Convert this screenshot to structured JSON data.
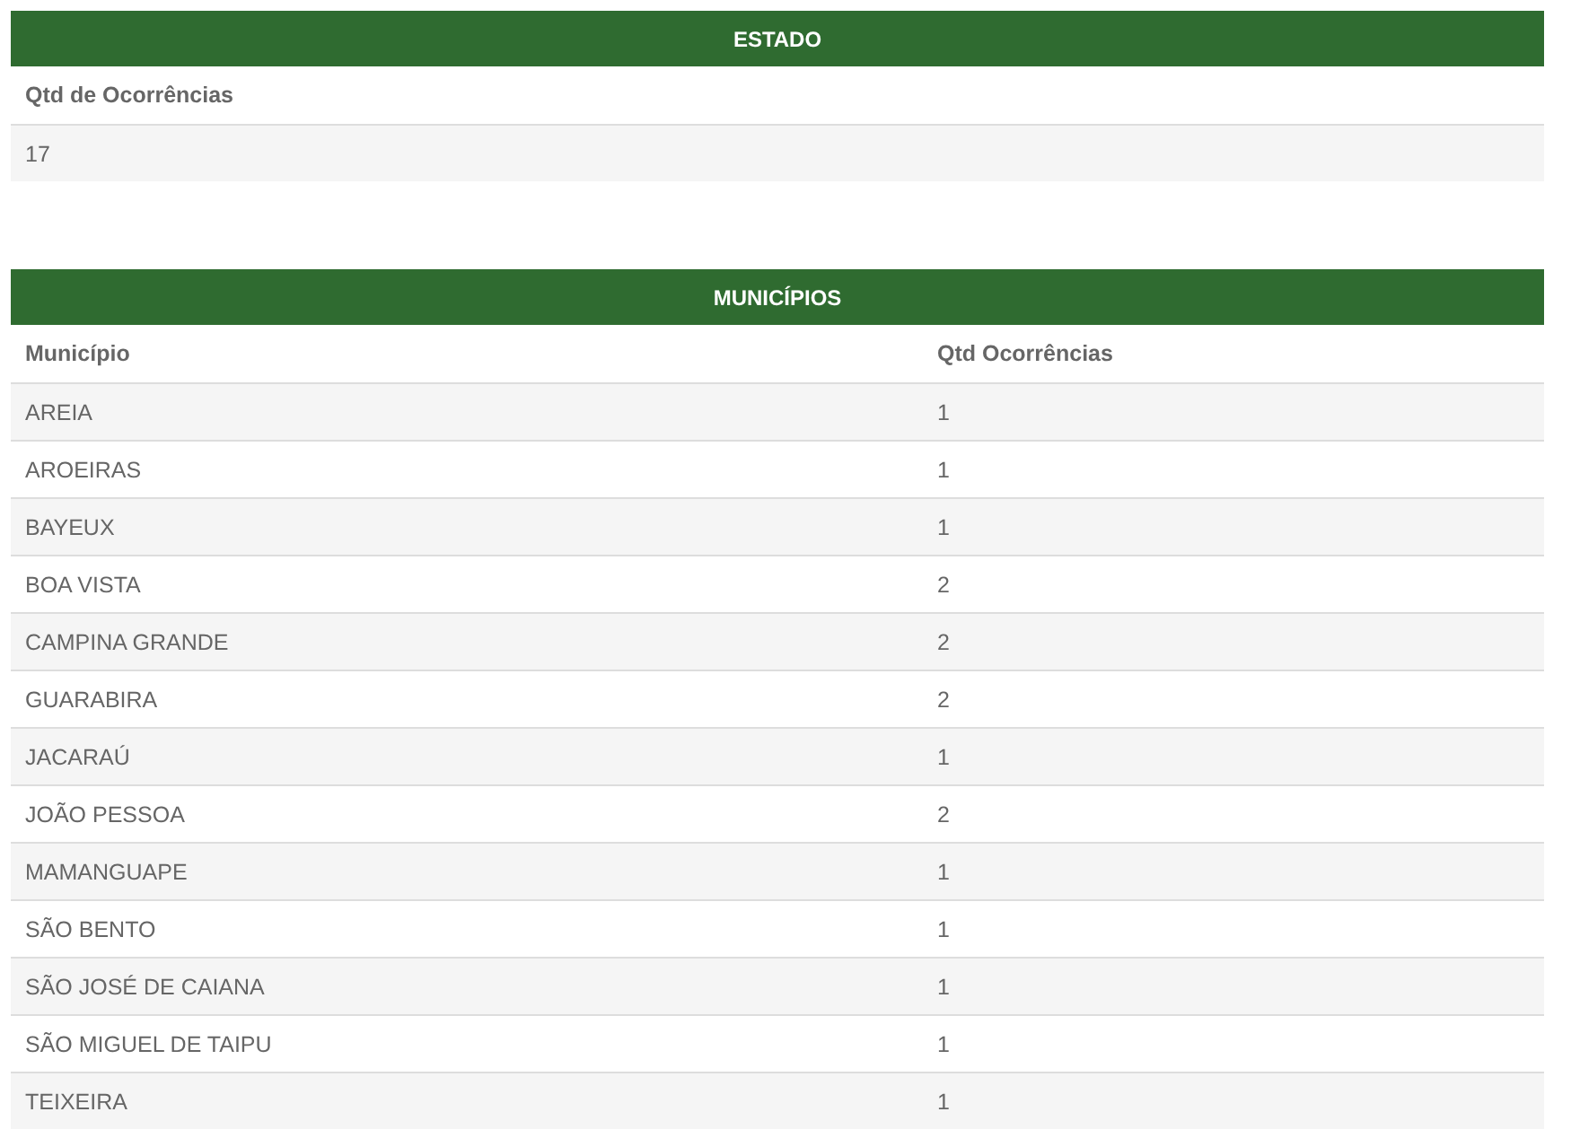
{
  "estado": {
    "title": "ESTADO",
    "columns": [
      "Qtd de Ocorrências"
    ],
    "rows": [
      [
        "17"
      ]
    ]
  },
  "municipios": {
    "title": "MUNICÍPIOS",
    "columns": [
      "Município",
      "Qtd Ocorrências"
    ],
    "rows": [
      [
        "AREIA",
        "1"
      ],
      [
        "AROEIRAS",
        "1"
      ],
      [
        "BAYEUX",
        "1"
      ],
      [
        "BOA VISTA",
        "2"
      ],
      [
        "CAMPINA GRANDE",
        "2"
      ],
      [
        "GUARABIRA",
        "2"
      ],
      [
        "JACARAÚ",
        "1"
      ],
      [
        "JOÃO PESSOA",
        "2"
      ],
      [
        "MAMANGUAPE",
        "1"
      ],
      [
        "SÃO BENTO",
        "1"
      ],
      [
        "SÃO JOSÉ DE CAIANA",
        "1"
      ],
      [
        "SÃO MIGUEL DE TAIPU",
        "1"
      ],
      [
        "TEIXEIRA",
        "1"
      ]
    ]
  }
}
